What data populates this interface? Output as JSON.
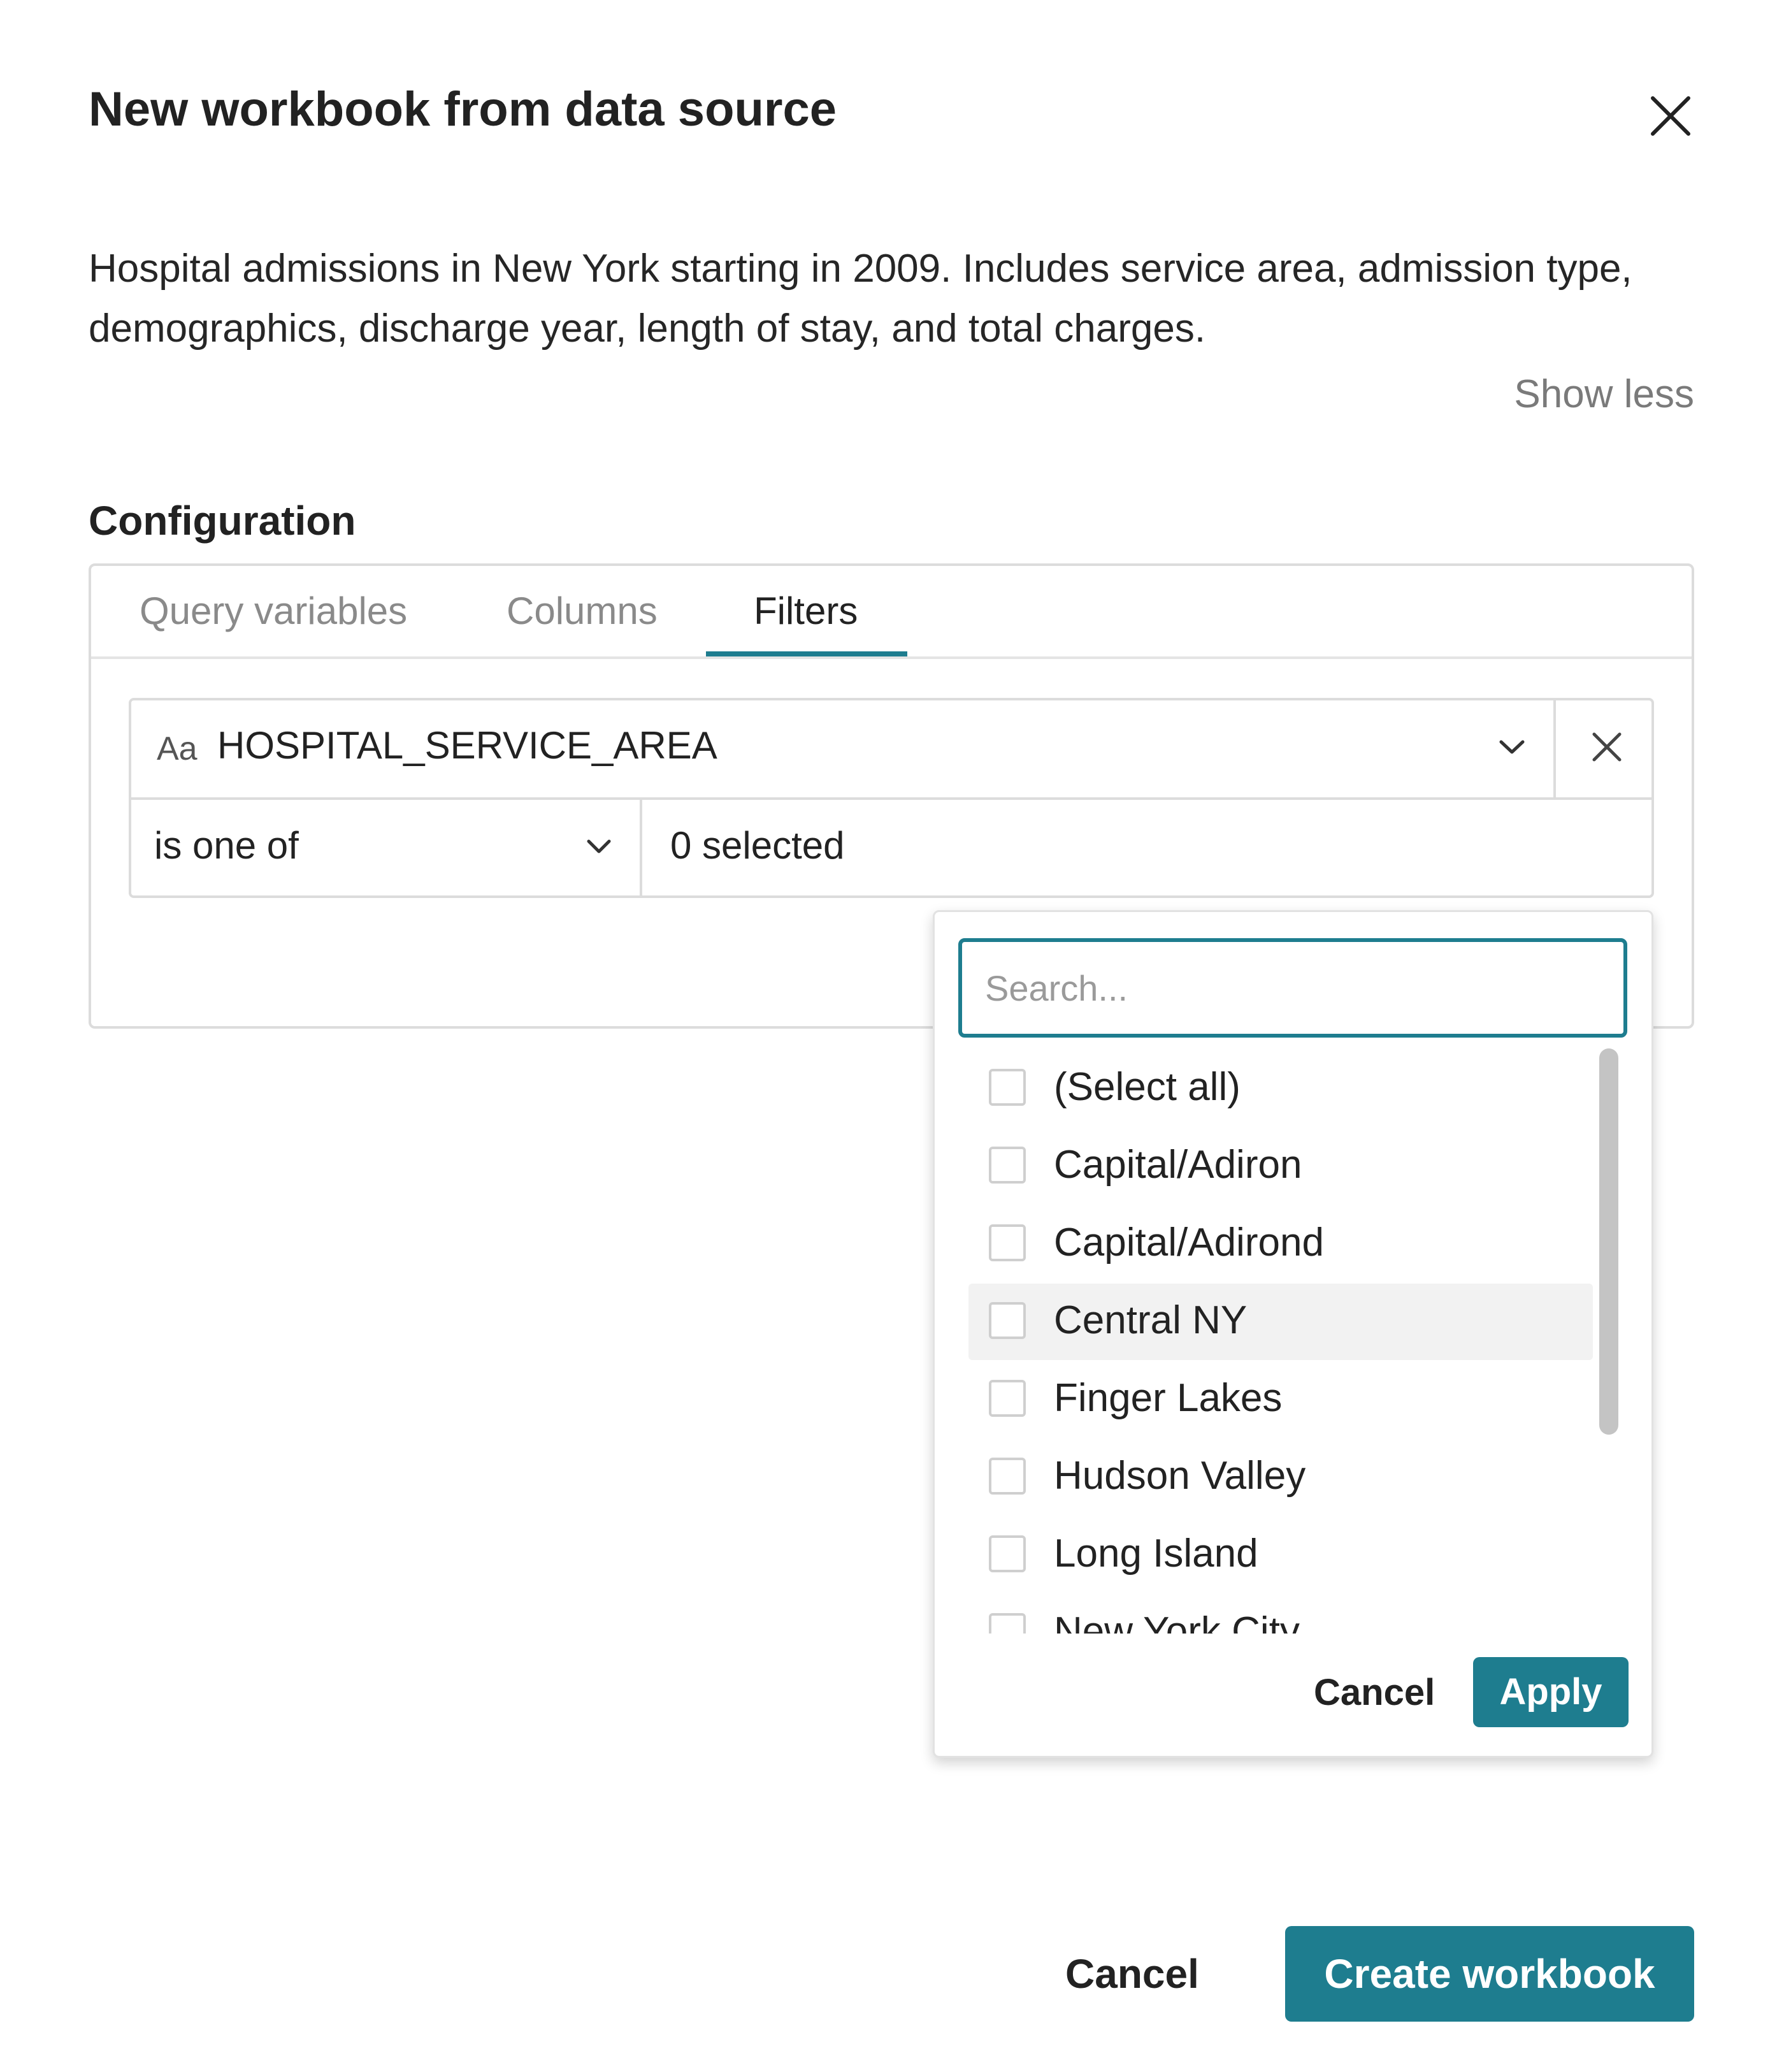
{
  "dialog": {
    "title": "New workbook from data source",
    "close_icon": "close-icon",
    "description": "Hospital admissions in New York starting in 2009. Includes service area, admission type, demographics, discharge year, length of stay, and total charges.",
    "show_less_label": "Show less"
  },
  "configuration": {
    "heading": "Configuration",
    "tabs": [
      {
        "label": "Query variables",
        "active": false
      },
      {
        "label": "Columns",
        "active": false
      },
      {
        "label": "Filters",
        "active": true
      }
    ]
  },
  "filter": {
    "type_icon_label": "Aa",
    "field_name": "HOSPITAL_SERVICE_AREA",
    "operator": "is one of",
    "value_summary": "0 selected"
  },
  "dropdown": {
    "search_placeholder": "Search...",
    "options": [
      {
        "label": "(Select all)",
        "checked": false
      },
      {
        "label": "Capital/Adiron",
        "checked": false
      },
      {
        "label": "Capital/Adirond",
        "checked": false
      },
      {
        "label": "Central NY",
        "checked": false,
        "highlighted": true
      },
      {
        "label": "Finger Lakes",
        "checked": false
      },
      {
        "label": "Hudson Valley",
        "checked": false
      },
      {
        "label": "Long Island",
        "checked": false
      },
      {
        "label": "New York City",
        "checked": false
      }
    ],
    "cancel_label": "Cancel",
    "apply_label": "Apply"
  },
  "footer": {
    "cancel_label": "Cancel",
    "create_label": "Create workbook"
  },
  "colors": {
    "accent": "#1e7d8f",
    "border": "#dcdcdc",
    "muted_text": "#8a8a8a"
  }
}
